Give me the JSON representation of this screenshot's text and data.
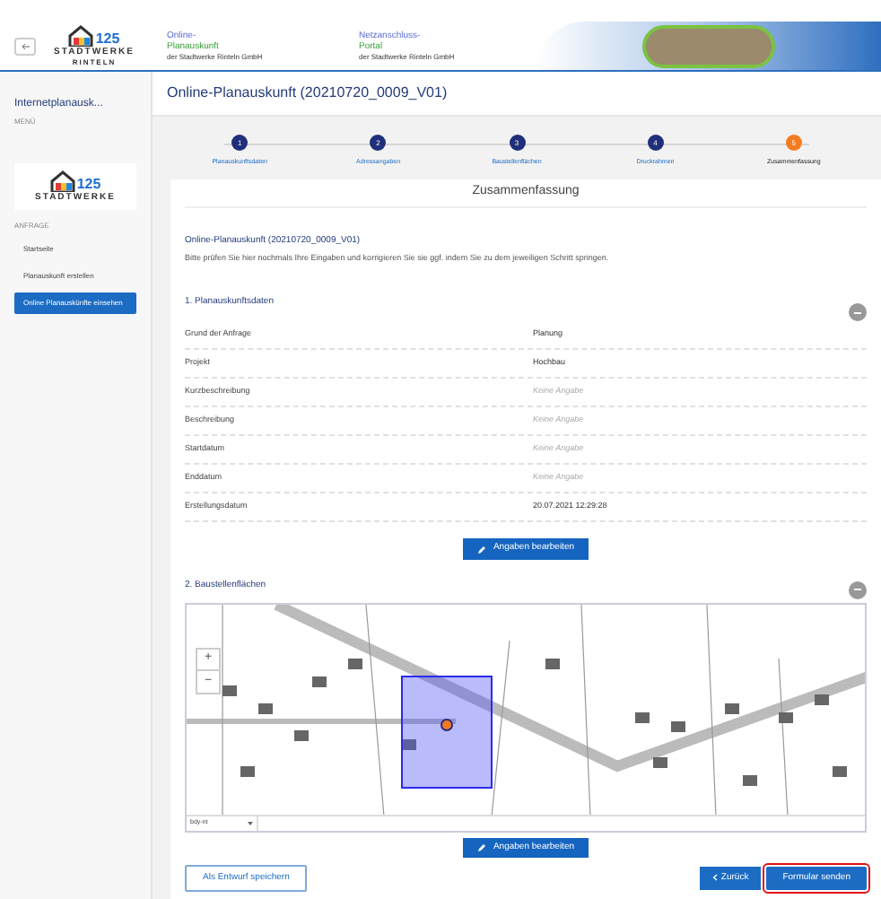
{
  "header": {
    "logo_number": "125",
    "logo_text": "STADTWERKE",
    "logo_subtext": "RINTELN",
    "portals": [
      {
        "title": "Online-",
        "title2": "Planauskunft",
        "subtitle": "der Stadtwerke Rinteln GmbH"
      },
      {
        "title": "Netzanschluss-",
        "title2": "Portal",
        "subtitle": "der Stadtwerke Rinteln GmbH"
      }
    ]
  },
  "sidebar": {
    "title": "Internetplanausk...",
    "subtitle": "MENÜ",
    "logo_number": "125",
    "logo_text": "STADTWERKE",
    "section": "ANFRAGE",
    "items": [
      {
        "label": "Startseite",
        "selected": false
      },
      {
        "label": "Planauskunft erstellen",
        "selected": false
      },
      {
        "label": "Online Planauskünfte einsehen",
        "selected": true
      }
    ]
  },
  "page_title": "Online-Planauskunft (20210720_0009_V01)",
  "steps": [
    {
      "number": "1",
      "label": "Planauskunftsdaten",
      "selected": false
    },
    {
      "number": "2",
      "label": "Adressangaben",
      "selected": false
    },
    {
      "number": "3",
      "label": "Baustellenflächen",
      "selected": false
    },
    {
      "number": "4",
      "label": "Druckrahmen",
      "selected": false
    },
    {
      "number": "5",
      "label": "Zusammenfassung",
      "selected": true
    }
  ],
  "summary": {
    "heading": "Zusammenfassung",
    "subtitle": "Online-Planauskunft (20210720_0009_V01)",
    "intro": "Bitte prüfen Sie hier nochmals Ihre Eingaben und korrigieren Sie sie ggf. indem Sie zu dem jeweiligen Schritt springen.",
    "section1": {
      "title": "1. Planauskunftsdaten",
      "rows": [
        {
          "label": "Grund der Anfrage",
          "value": "Planung",
          "empty": false
        },
        {
          "label": "Projekt",
          "value": "Hochbau",
          "empty": false
        },
        {
          "label": "Kurzbeschreibung",
          "value": "Keine Angabe",
          "empty": true
        },
        {
          "label": "Beschreibung",
          "value": "Keine Angabe",
          "empty": true
        },
        {
          "label": "Startdatum",
          "value": "Keine Angabe",
          "empty": true
        },
        {
          "label": "Enddatum",
          "value": "Keine Angabe",
          "empty": true
        },
        {
          "label": "Erstellungsdatum",
          "value": "20.07.2021 12:29:28",
          "empty": false
        }
      ],
      "edit_button": "Angaben bearbeiten"
    },
    "section2": {
      "title": "2. Baustellenflächen",
      "map_zoom_in": "+",
      "map_zoom_out": "−",
      "map_layer": "bdy-nt",
      "edit_button": "Angaben bearbeiten"
    }
  },
  "footer": {
    "draft_button": "Als Entwurf speichern",
    "back_button": "Zurück",
    "submit_button": "Formular senden",
    "submit_highlighted": true
  }
}
